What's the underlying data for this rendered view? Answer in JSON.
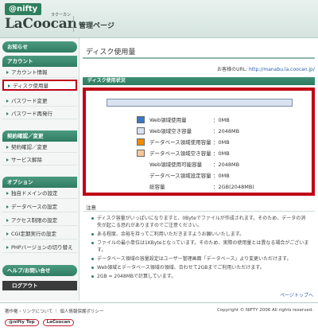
{
  "header": {
    "logo_nifty": "@nifty",
    "logo_lacoocan": "LaCoocan",
    "logo_ruby": "ラクーカン",
    "title": "管理ページ"
  },
  "sidebar": {
    "news": "お知らせ",
    "account_section": "アカウント",
    "account_items": [
      "アカウント情報",
      "ディスク使用量",
      "パスワード変更",
      "パスワード再発行"
    ],
    "contract_section": "契約確認／変更",
    "contract_items": [
      "契約確認／変更",
      "サービス解除"
    ],
    "option_section": "オプション",
    "option_items": [
      "独自ドメインの設定",
      "データベースの設定",
      "アクセス制限の設定",
      "CGI定期実行の設定",
      "PHPバージョンの切り替え"
    ],
    "help": "ヘルプ/お問い合せ",
    "logout": "ログアウト"
  },
  "main": {
    "page_title": "ディスク使用量",
    "url_label": "お客様のURL:",
    "url_prefix": "http://",
    "url_user": "manabu",
    "url_suffix": ".la.coocan.jp/",
    "status_heading": "ディスク使用状況",
    "usage": [
      {
        "label": "Web領域使用量",
        "value": "：0MB",
        "color": "#3a78c4"
      },
      {
        "label": "Web領域空き容量",
        "value": "：2048MB",
        "color": "#d9e3f0"
      },
      {
        "label": "データベース領域使用容量",
        "value": "：0MB",
        "color": "#f08c00"
      },
      {
        "label": "データベース領域空き容量",
        "value": "：0MB",
        "color": "#f7c898"
      },
      {
        "label": "Web領域使用可能容量",
        "value": "：2048MB",
        "color": ""
      },
      {
        "label": "データベース領域設定容量",
        "value": "：0MB",
        "color": ""
      },
      {
        "label": "総容量",
        "value": "：2GB(2048MB)",
        "color": ""
      }
    ],
    "note_title": "注意",
    "notes": [
      "ディスク容量がいっぱいになりますと、0Byteでファイルが作成されます。そのため、データの消失が起こる恐れがありますのでご注意ください。",
      "ある程度、余裕を持ってご利用いただきますようお願いいたします。",
      "ファイルの最小単位は1KByteとなっています。そのため、実際の使用量とは異なる場合がございます。",
      "データベース領域の容量設定はユーザー管理画面「データベース」より変更いただけます。",
      "Web領域とデータベース領域の領域、合わせて2GBまでご利用いただけます。",
      "2GB = 2048MBで計算しています。"
    ],
    "pagetop": "ページトップへ"
  },
  "footer": {
    "links": "著作権・リンクについて ｜ 個人情報保護ポリシー",
    "copyright": "Copyright © NIFTY 2006 All rights reserved.",
    "logo_nifty_top": "@nifty Top",
    "logo_lacoocan": "LaCoocan"
  }
}
